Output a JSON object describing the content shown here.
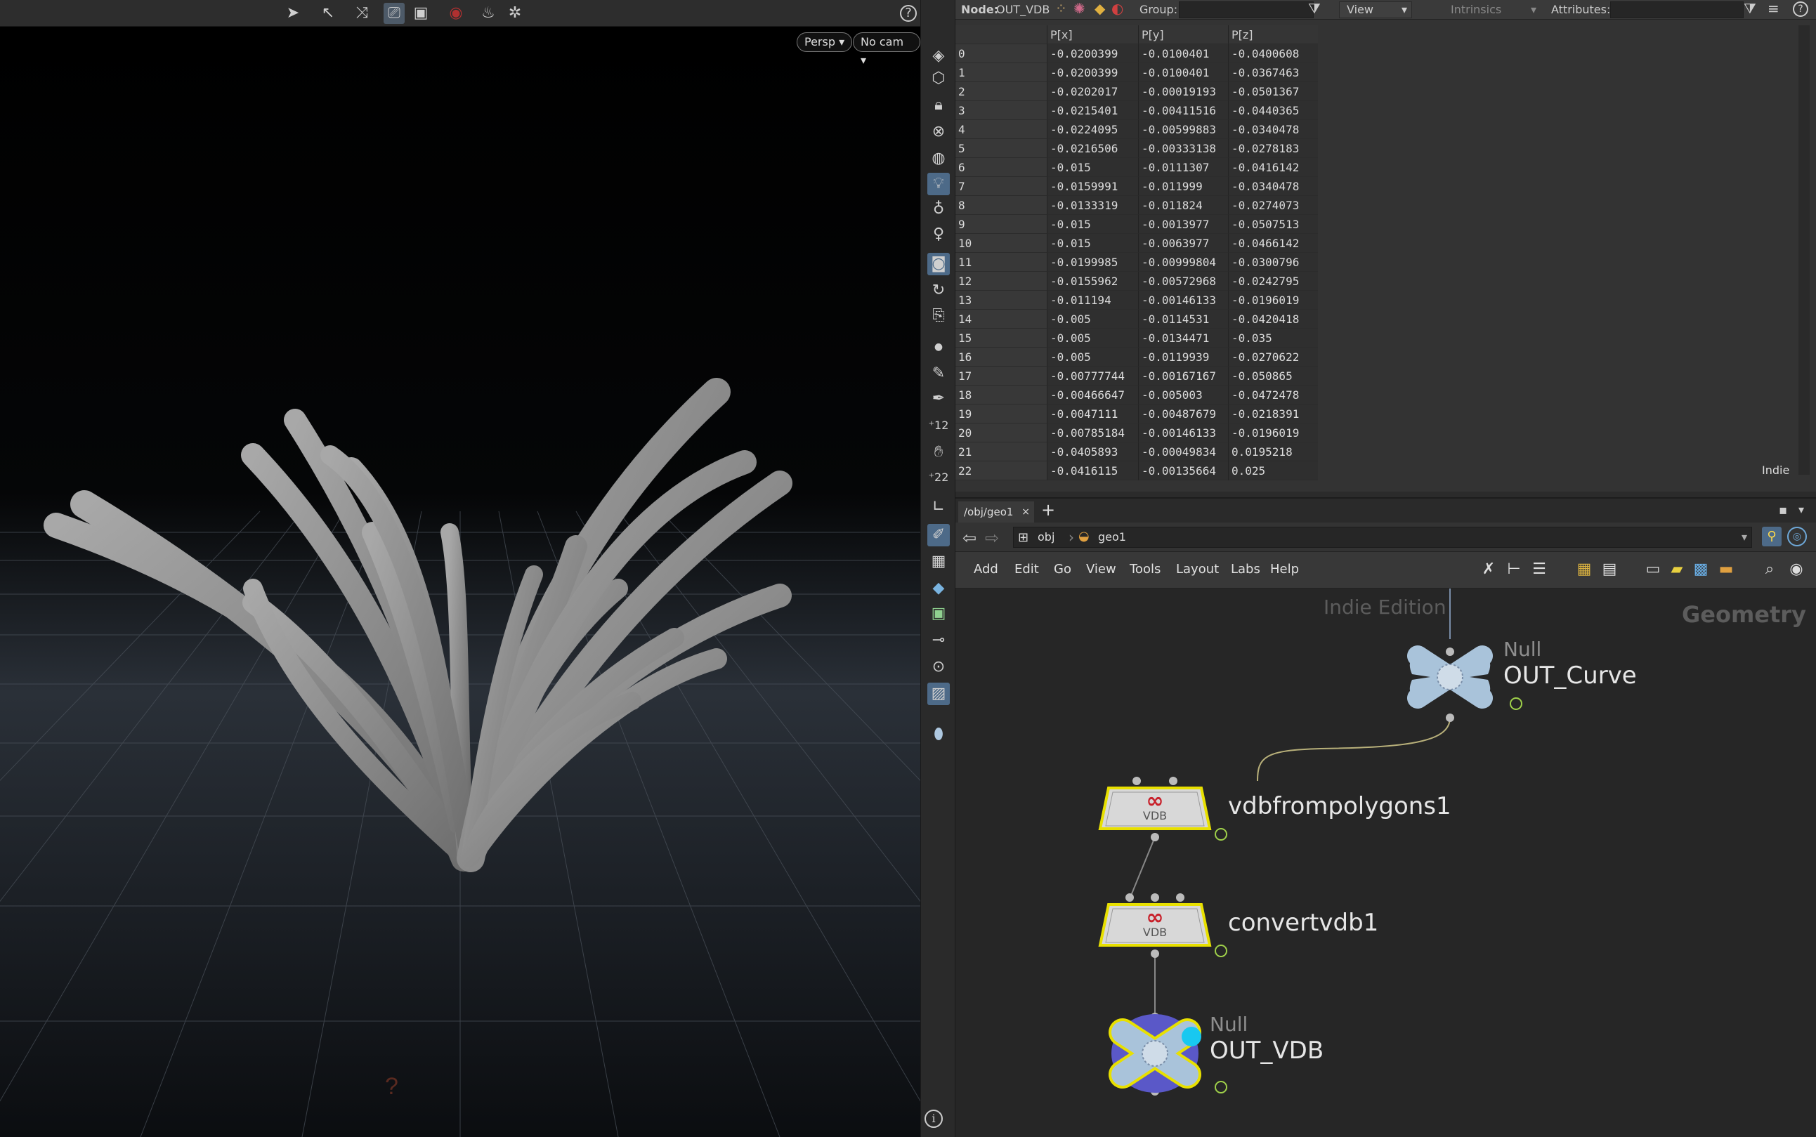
{
  "viewport": {
    "camera_mode": "Persp",
    "camera": "No cam",
    "toolbar_icons": [
      "select-icon",
      "transform-icon",
      "pose-icon",
      "view-camera-icon",
      "snapshot-icon",
      "record-icon",
      "render-icon",
      "settings-icon"
    ],
    "help": "?"
  },
  "shelf": {
    "icons": [
      "display-options-icon",
      "geometry-icon",
      "lock-icon",
      "pin-icon",
      "sphere-icon",
      "light-icon",
      "light-bulb-icon",
      "pointer-icon",
      "shade-icon",
      "rotate-icon",
      "camera-path-icon",
      "dot-icon",
      "brush-icon",
      "pen-icon",
      "counter-12-icon",
      "hand-icon",
      "counter-22-icon",
      "angle-icon",
      "paint-icon",
      "checker-icon",
      "diamond-icon",
      "box-icon",
      "slider-icon",
      "circle-icon",
      "image-icon",
      "location-icon"
    ]
  },
  "spreadsheet": {
    "node_label": "Node:",
    "node_name": "OUT_VDB",
    "group_label": "Group:",
    "view_label": "View",
    "intrinsics_label": "Intrinsics",
    "attributes_label": "Attributes:",
    "watermark": "Indie",
    "columns": [
      "",
      "P[x]",
      "P[y]",
      "P[z]"
    ],
    "rows": [
      [
        "0",
        "-0.0200399",
        "-0.0100401",
        "-0.0400608"
      ],
      [
        "1",
        "-0.0200399",
        "-0.0100401",
        "-0.0367463"
      ],
      [
        "2",
        "-0.0202017",
        "-0.00019193",
        "-0.0501367"
      ],
      [
        "3",
        "-0.0215401",
        "-0.00411516",
        "-0.0440365"
      ],
      [
        "4",
        "-0.0224095",
        "-0.00599883",
        "-0.0340478"
      ],
      [
        "5",
        "-0.0216506",
        "-0.00333138",
        "-0.0278183"
      ],
      [
        "6",
        "-0.015",
        "-0.0111307",
        "-0.0416142"
      ],
      [
        "7",
        "-0.0159991",
        "-0.011999",
        "-0.0340478"
      ],
      [
        "8",
        "-0.0133319",
        "-0.011824",
        "-0.0274073"
      ],
      [
        "9",
        "-0.015",
        "-0.0013977",
        "-0.0507513"
      ],
      [
        "10",
        "-0.015",
        "-0.0063977",
        "-0.0466142"
      ],
      [
        "11",
        "-0.0199985",
        "-0.00999804",
        "-0.0300796"
      ],
      [
        "12",
        "-0.0155962",
        "-0.00572968",
        "-0.0242795"
      ],
      [
        "13",
        "-0.011194",
        "-0.00146133",
        "-0.0196019"
      ],
      [
        "14",
        "-0.005",
        "-0.0114531",
        "-0.0420418"
      ],
      [
        "15",
        "-0.005",
        "-0.0134471",
        "-0.035"
      ],
      [
        "16",
        "-0.005",
        "-0.0119939",
        "-0.0270622"
      ],
      [
        "17",
        "-0.00777744",
        "-0.00167167",
        "-0.050865"
      ],
      [
        "18",
        "-0.00466647",
        "-0.005003",
        "-0.0472478"
      ],
      [
        "19",
        "-0.0047111",
        "-0.00487679",
        "-0.0218391"
      ],
      [
        "20",
        "-0.00785184",
        "-0.00146133",
        "-0.0196019"
      ],
      [
        "21",
        "-0.0405893",
        "-0.00049834",
        "0.0195218"
      ],
      [
        "22",
        "-0.0416115",
        "-0.00135664",
        "0.025"
      ]
    ]
  },
  "network": {
    "tab_label": "/obj/geo1",
    "tab_close": "×",
    "tab_add": "+",
    "path": [
      "obj",
      "geo1"
    ],
    "menu": [
      "Add",
      "Edit",
      "Go",
      "View",
      "Tools",
      "Layout",
      "Labs",
      "Help"
    ],
    "watermark": "Indie Edition",
    "context": "Geometry",
    "nodes": [
      {
        "type": "Null",
        "name": "OUT_Curve"
      },
      {
        "type": "",
        "name": "vdbfrompolygons1",
        "badge": "VDB"
      },
      {
        "type": "",
        "name": "convertvdb1",
        "badge": "VDB"
      },
      {
        "type": "Null",
        "name": "OUT_VDB"
      }
    ]
  },
  "colors": {
    "accent": "#4d6a88",
    "node_outline_selected": "#e8e000",
    "null_node": "#a9c3da",
    "vdb_node": "#d8d8d8",
    "vdb_logo": "#c8202a"
  }
}
